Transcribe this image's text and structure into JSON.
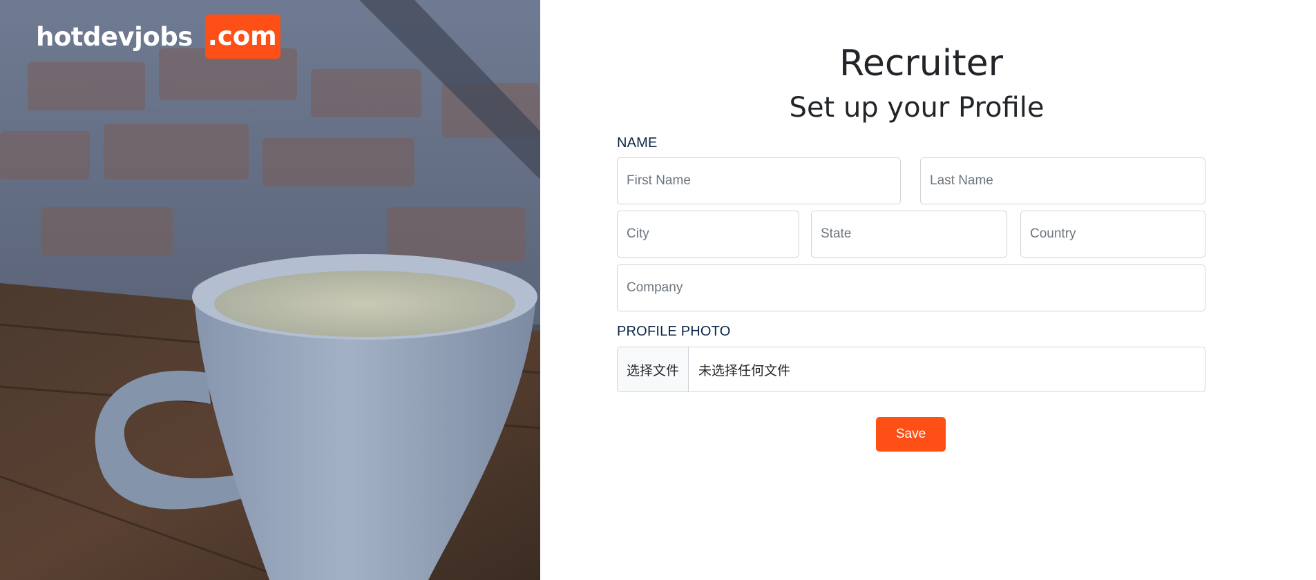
{
  "brand": {
    "name": "hotdevjobs",
    "tld": ".com",
    "accent_color": "#fd4f16"
  },
  "hero": {
    "image": "coffee-cup-photo"
  },
  "form": {
    "title": "Recruiter",
    "subtitle": "Set up your Profile",
    "name_section_label": "NAME",
    "fields": {
      "first_name": {
        "placeholder": "First Name",
        "value": ""
      },
      "last_name": {
        "placeholder": "Last Name",
        "value": ""
      },
      "city": {
        "placeholder": "City",
        "value": ""
      },
      "state": {
        "placeholder": "State",
        "value": ""
      },
      "country": {
        "placeholder": "Country",
        "value": ""
      },
      "company": {
        "placeholder": "Company",
        "value": ""
      }
    },
    "photo_section_label": "PROFILE PHOTO",
    "file_button_label": "选择文件",
    "file_status": "未选择任何文件",
    "save_label": "Save"
  }
}
